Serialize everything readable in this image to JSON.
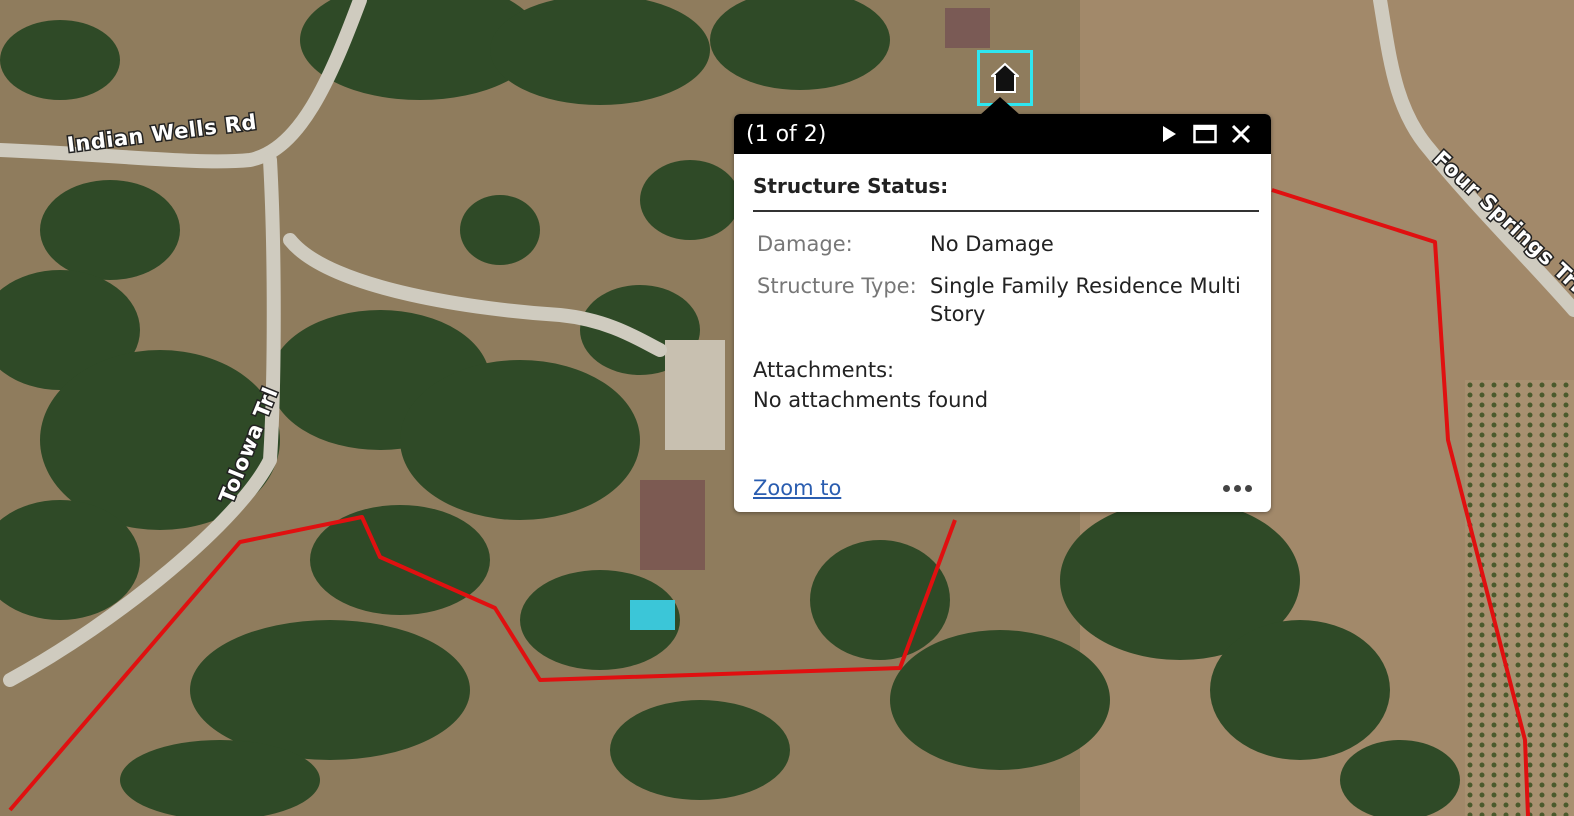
{
  "map": {
    "roads": [
      {
        "name": "Indian Wells Rd"
      },
      {
        "name": "Tolowa Trl"
      },
      {
        "name": "Four Springs Trl"
      }
    ],
    "boundary_color": "#e01010",
    "selection_color": "#2ee6f0"
  },
  "popup": {
    "counter": "(1 of 2)",
    "section_title": "Structure Status:",
    "fields": [
      {
        "label": "Damage:",
        "value": "No Damage"
      },
      {
        "label": "Structure Type:",
        "value": "Single Family Residence Multi Story"
      }
    ],
    "attachments_label": "Attachments:",
    "attachments_value": "No attachments found",
    "zoom_label": "Zoom to",
    "icons": {
      "next": "play-icon",
      "maximize": "maximize-icon",
      "close": "close-icon",
      "more": "ellipsis-icon",
      "marker": "house-icon"
    }
  }
}
